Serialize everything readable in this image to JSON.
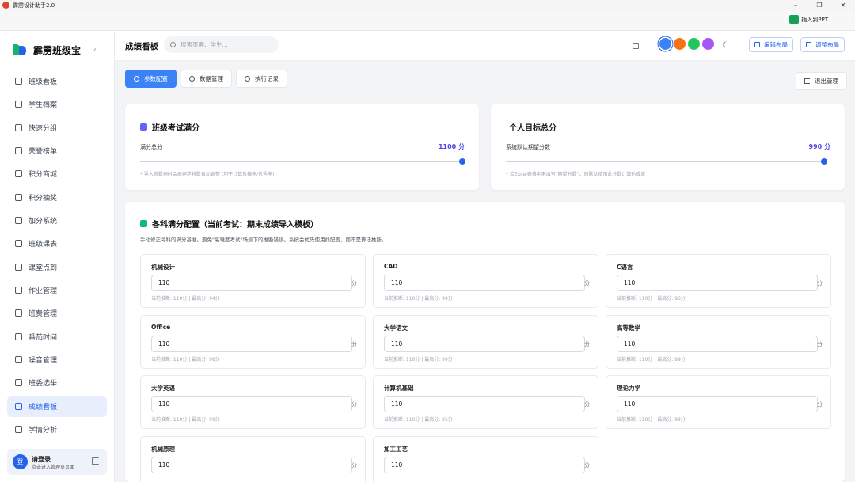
{
  "window": {
    "title": "霹雳设计助手2.0",
    "controls": [
      "–",
      "❐",
      "✕"
    ],
    "ribbon_button": "插入到PPT"
  },
  "brand": {
    "name": "霹雳班级宝",
    "collapse": "‹"
  },
  "sidebar": {
    "items": [
      {
        "label": "班级看板"
      },
      {
        "label": "学生档案"
      },
      {
        "label": "快速分组"
      },
      {
        "label": "荣誉榜单"
      },
      {
        "label": "积分商城"
      },
      {
        "label": "积分抽奖"
      },
      {
        "label": "加分系统"
      },
      {
        "label": "班级课表"
      },
      {
        "label": "课堂点到"
      },
      {
        "label": "作业管理"
      },
      {
        "label": "班费管理"
      },
      {
        "label": "番茄时间"
      },
      {
        "label": "噪音管理"
      },
      {
        "label": "班委选举"
      },
      {
        "label": "成绩看板",
        "active": true
      },
      {
        "label": "学情分析"
      }
    ]
  },
  "user": {
    "avatar": "登",
    "name": "请登录",
    "hint": "点击进入管理员页面"
  },
  "header": {
    "title": "成绩看板",
    "search_placeholder": "搜索页面、学生...",
    "theme_colors": [
      "#3b82f6",
      "#f97316",
      "#22c55e",
      "#a855f7"
    ],
    "moon": "☾",
    "edit_layout": "编辑布局",
    "adjust_layout": "调整布局"
  },
  "tabs": [
    {
      "label": "参数配置",
      "active": true
    },
    {
      "label": "数据管理"
    },
    {
      "label": "执行记录"
    }
  ],
  "exit_button": "退出管理",
  "exam_full": {
    "title": "班级考试满分",
    "label": "满分总分",
    "value": "1100 分",
    "fraction": 1.0,
    "hint": "* 导入新数据时会根据学科数自动调整 (用于计算及格率/优秀率)"
  },
  "personal_goal": {
    "title": "个人目标总分",
    "label": "系统默认期望分数",
    "value": "990 分",
    "fraction": 1.0,
    "hint": "* 若Excel表格中未填写\"期望分数\"，则默认使用此分数计算达成度"
  },
  "subjects_card": {
    "title": "各科满分配置（当前考试：期末成绩导入模板）",
    "desc": "手动修正每科的满分基准。避免\"高难度考试\"场景下的推断错误。系统会优先使用此配置，而不是算法推断。",
    "unit": "分",
    "subjects": [
      {
        "name": "机械设计",
        "value": "110",
        "info": "当前推断: 110分 | 最高分: 94分"
      },
      {
        "name": "CAD",
        "value": "110",
        "info": "当前推断: 110分 | 最高分: 99分"
      },
      {
        "name": "C语言",
        "value": "110",
        "info": "当前推断: 110分 | 最高分: 96分"
      },
      {
        "name": "Office",
        "value": "110",
        "info": "当前推断: 110分 | 最高分: 98分"
      },
      {
        "name": "大学语文",
        "value": "110",
        "info": "当前推断: 110分 | 最高分: 99分"
      },
      {
        "name": "高等数学",
        "value": "110",
        "info": "当前推断: 110分 | 最高分: 99分"
      },
      {
        "name": "大学英语",
        "value": "110",
        "info": "当前推断: 110分 | 最高分: 99分"
      },
      {
        "name": "计算机基础",
        "value": "110",
        "info": "当前推断: 110分 | 最高分: 95分"
      },
      {
        "name": "理论力学",
        "value": "110",
        "info": "当前推断: 110分 | 最高分: 99分"
      },
      {
        "name": "机械原理",
        "value": "110",
        "info": ""
      },
      {
        "name": "加工工艺",
        "value": "110",
        "info": ""
      }
    ]
  }
}
